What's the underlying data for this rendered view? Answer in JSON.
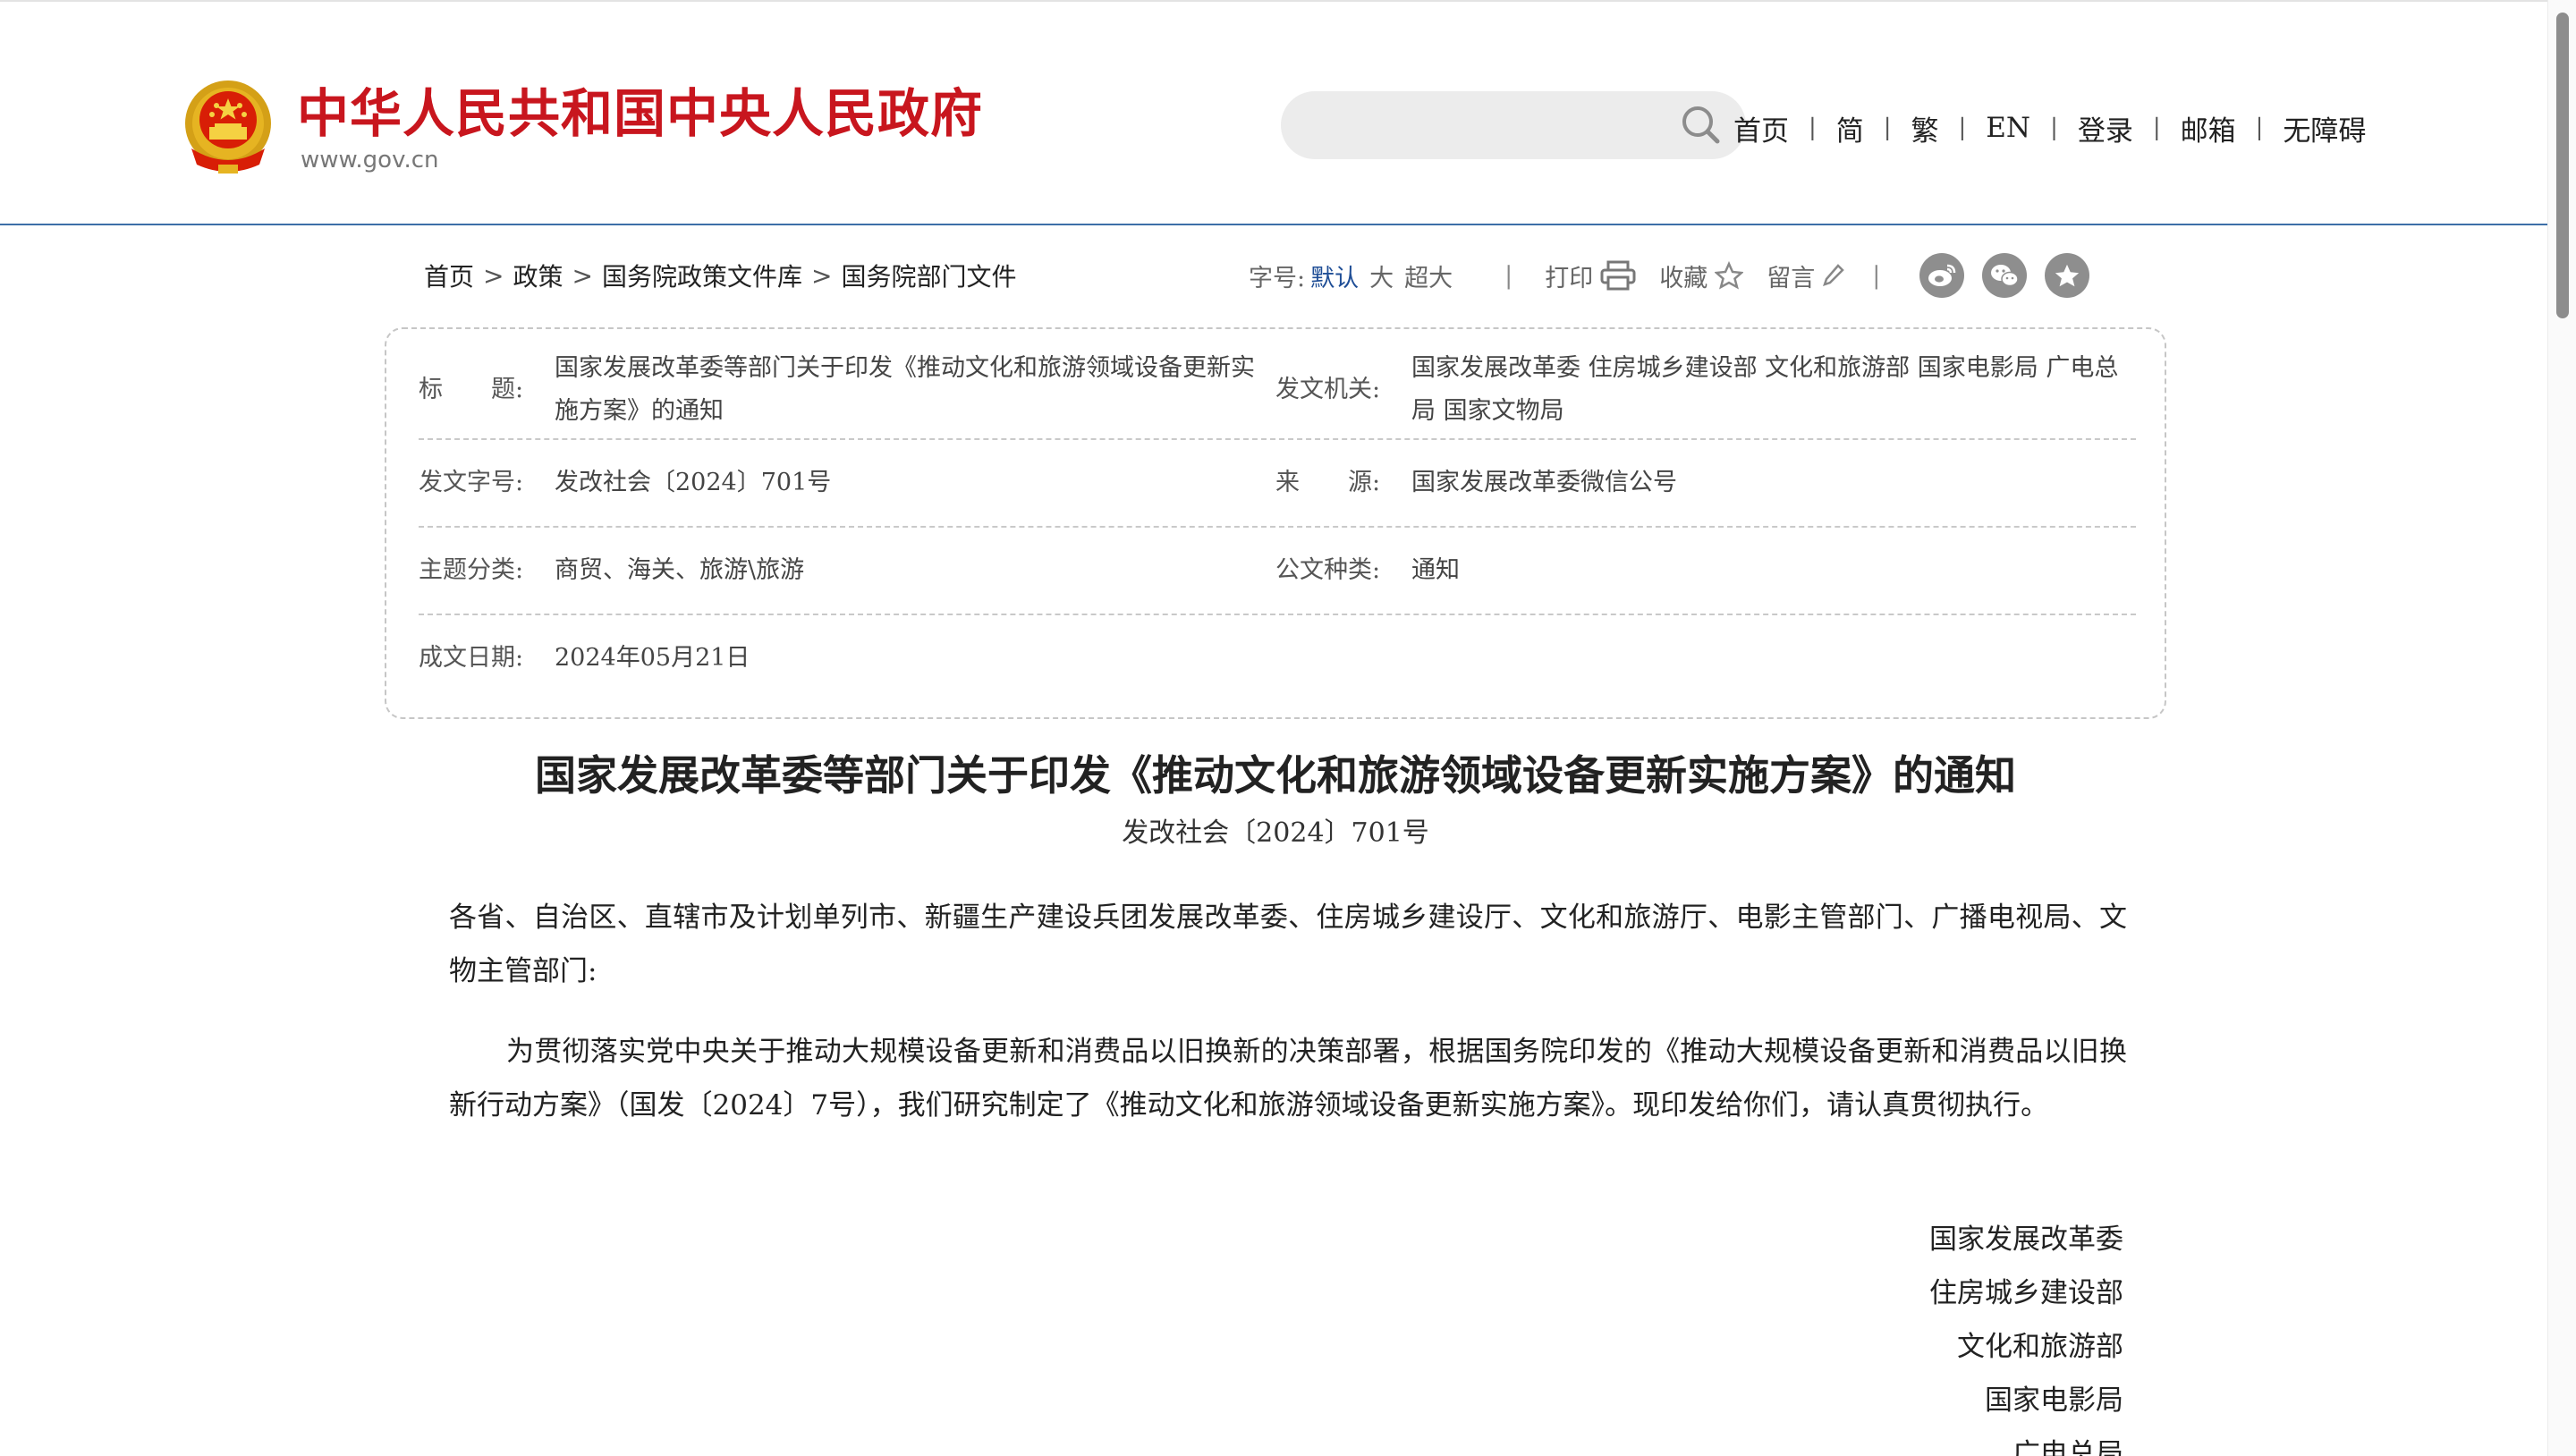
{
  "header": {
    "site_title": "中华人民共和国中央人民政府",
    "site_url": "www.gov.cn",
    "search": {
      "placeholder": "",
      "value": ""
    },
    "nav": [
      "首页",
      "简",
      "繁",
      "EN",
      "登录",
      "邮箱",
      "无障碍"
    ],
    "nav_separator": "|"
  },
  "breadcrumb": {
    "items": [
      "首页",
      "政策",
      "国务院政策文件库",
      "国务院部门文件"
    ],
    "separator": ">"
  },
  "toolbar": {
    "font_size_label": "字号:",
    "font_default": "默认",
    "font_large": "大",
    "font_xlarge": "超大",
    "separator": "|",
    "print_label": "打印",
    "favorite_label": "收藏",
    "comment_label": "留言"
  },
  "info": {
    "title_label": "标　　题:",
    "title_value": "国家发展改革委等部门关于印发《推动文化和旅游领域设备更新实施方案》的通知",
    "issuer_label": "发文机关:",
    "issuer_value": "国家发展改革委 住房城乡建设部 文化和旅游部 国家电影局 广电总局 国家文物局",
    "docno_label": "发文字号:",
    "docno_value": "发改社会〔2024〕701号",
    "source_label": "来　　源:",
    "source_value": "国家发展改革委微信公号",
    "topic_label": "主题分类:",
    "topic_value": "商贸、海关、旅游\\旅游",
    "type_label": "公文种类:",
    "type_value": "通知",
    "date_label": "成文日期:",
    "date_value": "2024年05月21日"
  },
  "article": {
    "title": "国家发展改革委等部门关于印发《推动文化和旅游领域设备更新实施方案》的通知",
    "doc_number": "发改社会〔2024〕701号",
    "salutation": "各省、自治区、直辖市及计划单列市、新疆生产建设兵团发展改革委、住房城乡建设厅、文化和旅游厅、电影主管部门、广播电视局、文物主管部门:",
    "body": "为贯彻落实党中央关于推动大规模设备更新和消费品以旧换新的决策部署，根据国务院印发的《推动大规模设备更新和消费品以旧换新行动方案》（国发〔2024〕7号），我们研究制定了《推动文化和旅游领域设备更新实施方案》。现印发给你们，请认真贯彻执行。",
    "signatories": [
      "国家发展改革委",
      "住房城乡建设部",
      "文化和旅游部",
      "国家电影局",
      "广电总局"
    ]
  },
  "colors": {
    "brand_red": "#c8161e",
    "accent_blue": "#1f4e96",
    "header_rule": "#3d6fa8",
    "share_icon_gray": "#8e8e8e"
  },
  "icons": {
    "emblem": "national-emblem-icon",
    "search": "search-icon",
    "print": "printer-icon",
    "favorite": "star-icon",
    "comment": "pencil-icon",
    "share": [
      "weibo-icon",
      "wechat-icon",
      "collect-icon"
    ]
  }
}
